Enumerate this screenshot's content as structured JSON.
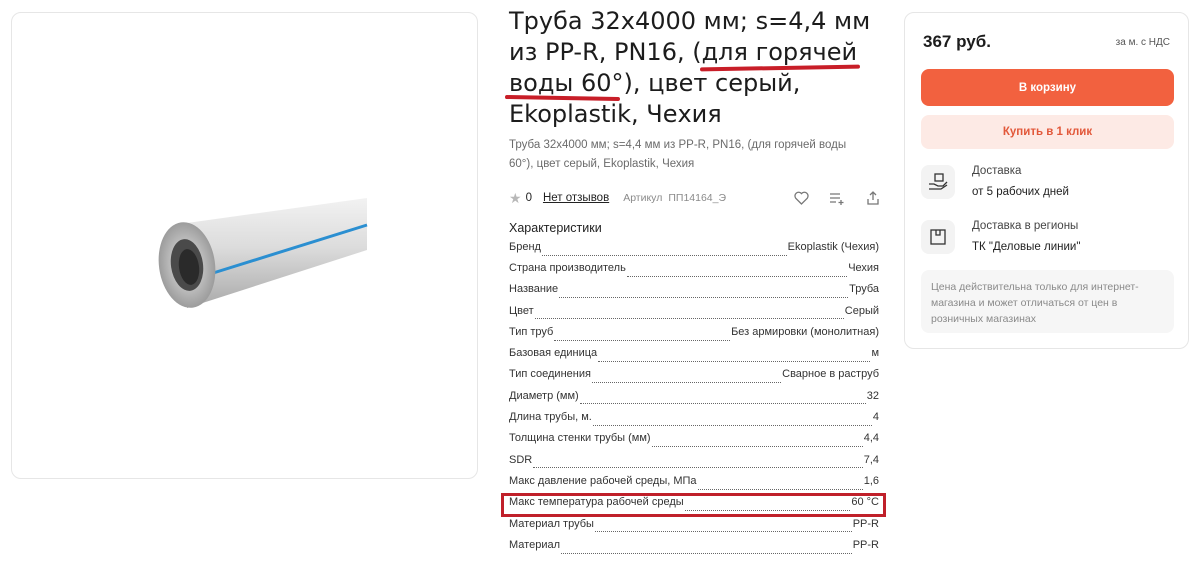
{
  "product": {
    "title": "Труба 32х4000 мм; s=4,4 мм из PP-R, PN16, (для горячей воды 60°), цвет серый, Ekoplastik, Чехия",
    "subtitle": "Труба 32х4000 мм; s=4,4 мм из PP-R, PN16, (для горячей воды 60°), цвет серый, Ekoplastik, Чехия",
    "image_icon": "pipe-image"
  },
  "meta": {
    "rating": "0",
    "reviews_label": "Нет отзывов",
    "article_label": "Артикул",
    "article_value": "ПП14164_Э",
    "icons": [
      "heart-icon",
      "compare-icon",
      "share-icon"
    ]
  },
  "specs": {
    "heading": "Характеристики",
    "rows": [
      {
        "label": "Бренд",
        "value": "Ekoplastik (Чехия)"
      },
      {
        "label": "Страна производитель",
        "value": "Чехия"
      },
      {
        "label": "Название",
        "value": "Труба"
      },
      {
        "label": "Цвет",
        "value": "Серый"
      },
      {
        "label": "Тип труб",
        "value": "Без армировки (монолитная)"
      },
      {
        "label": "Базовая единица",
        "value": "м"
      },
      {
        "label": "Тип соединения",
        "value": "Сварное в раструб"
      },
      {
        "label": "Диаметр (мм)",
        "value": "32"
      },
      {
        "label": "Длина трубы, м.",
        "value": "4"
      },
      {
        "label": "Толщина стенки трубы (мм)",
        "value": "4,4"
      },
      {
        "label": "SDR",
        "value": "7,4"
      },
      {
        "label": "Макс давление рабочей среды, МПа",
        "value": "1,6"
      },
      {
        "label": "Макс температура рабочей среды",
        "value": "60 °C"
      },
      {
        "label": "Материал трубы",
        "value": "PP-R"
      },
      {
        "label": "Материал",
        "value": "PP-R"
      }
    ]
  },
  "buy": {
    "price": "367 руб.",
    "price_note": "за м. с НДС",
    "cart_label": "В корзину",
    "quick_label": "Купить в 1 клик",
    "delivery_title": "Доставка",
    "delivery_value": "от 5 рабочих дней",
    "regions_title": "Доставка в регионы",
    "regions_value": "ТК \"Деловые линии\"",
    "notice": "Цена действительна только для интернет-магазина и может отличаться от цен в розничных магазинах"
  },
  "colors": {
    "accent": "#f2613f",
    "accent_light": "#fdeae5",
    "highlight": "#c0202a"
  }
}
